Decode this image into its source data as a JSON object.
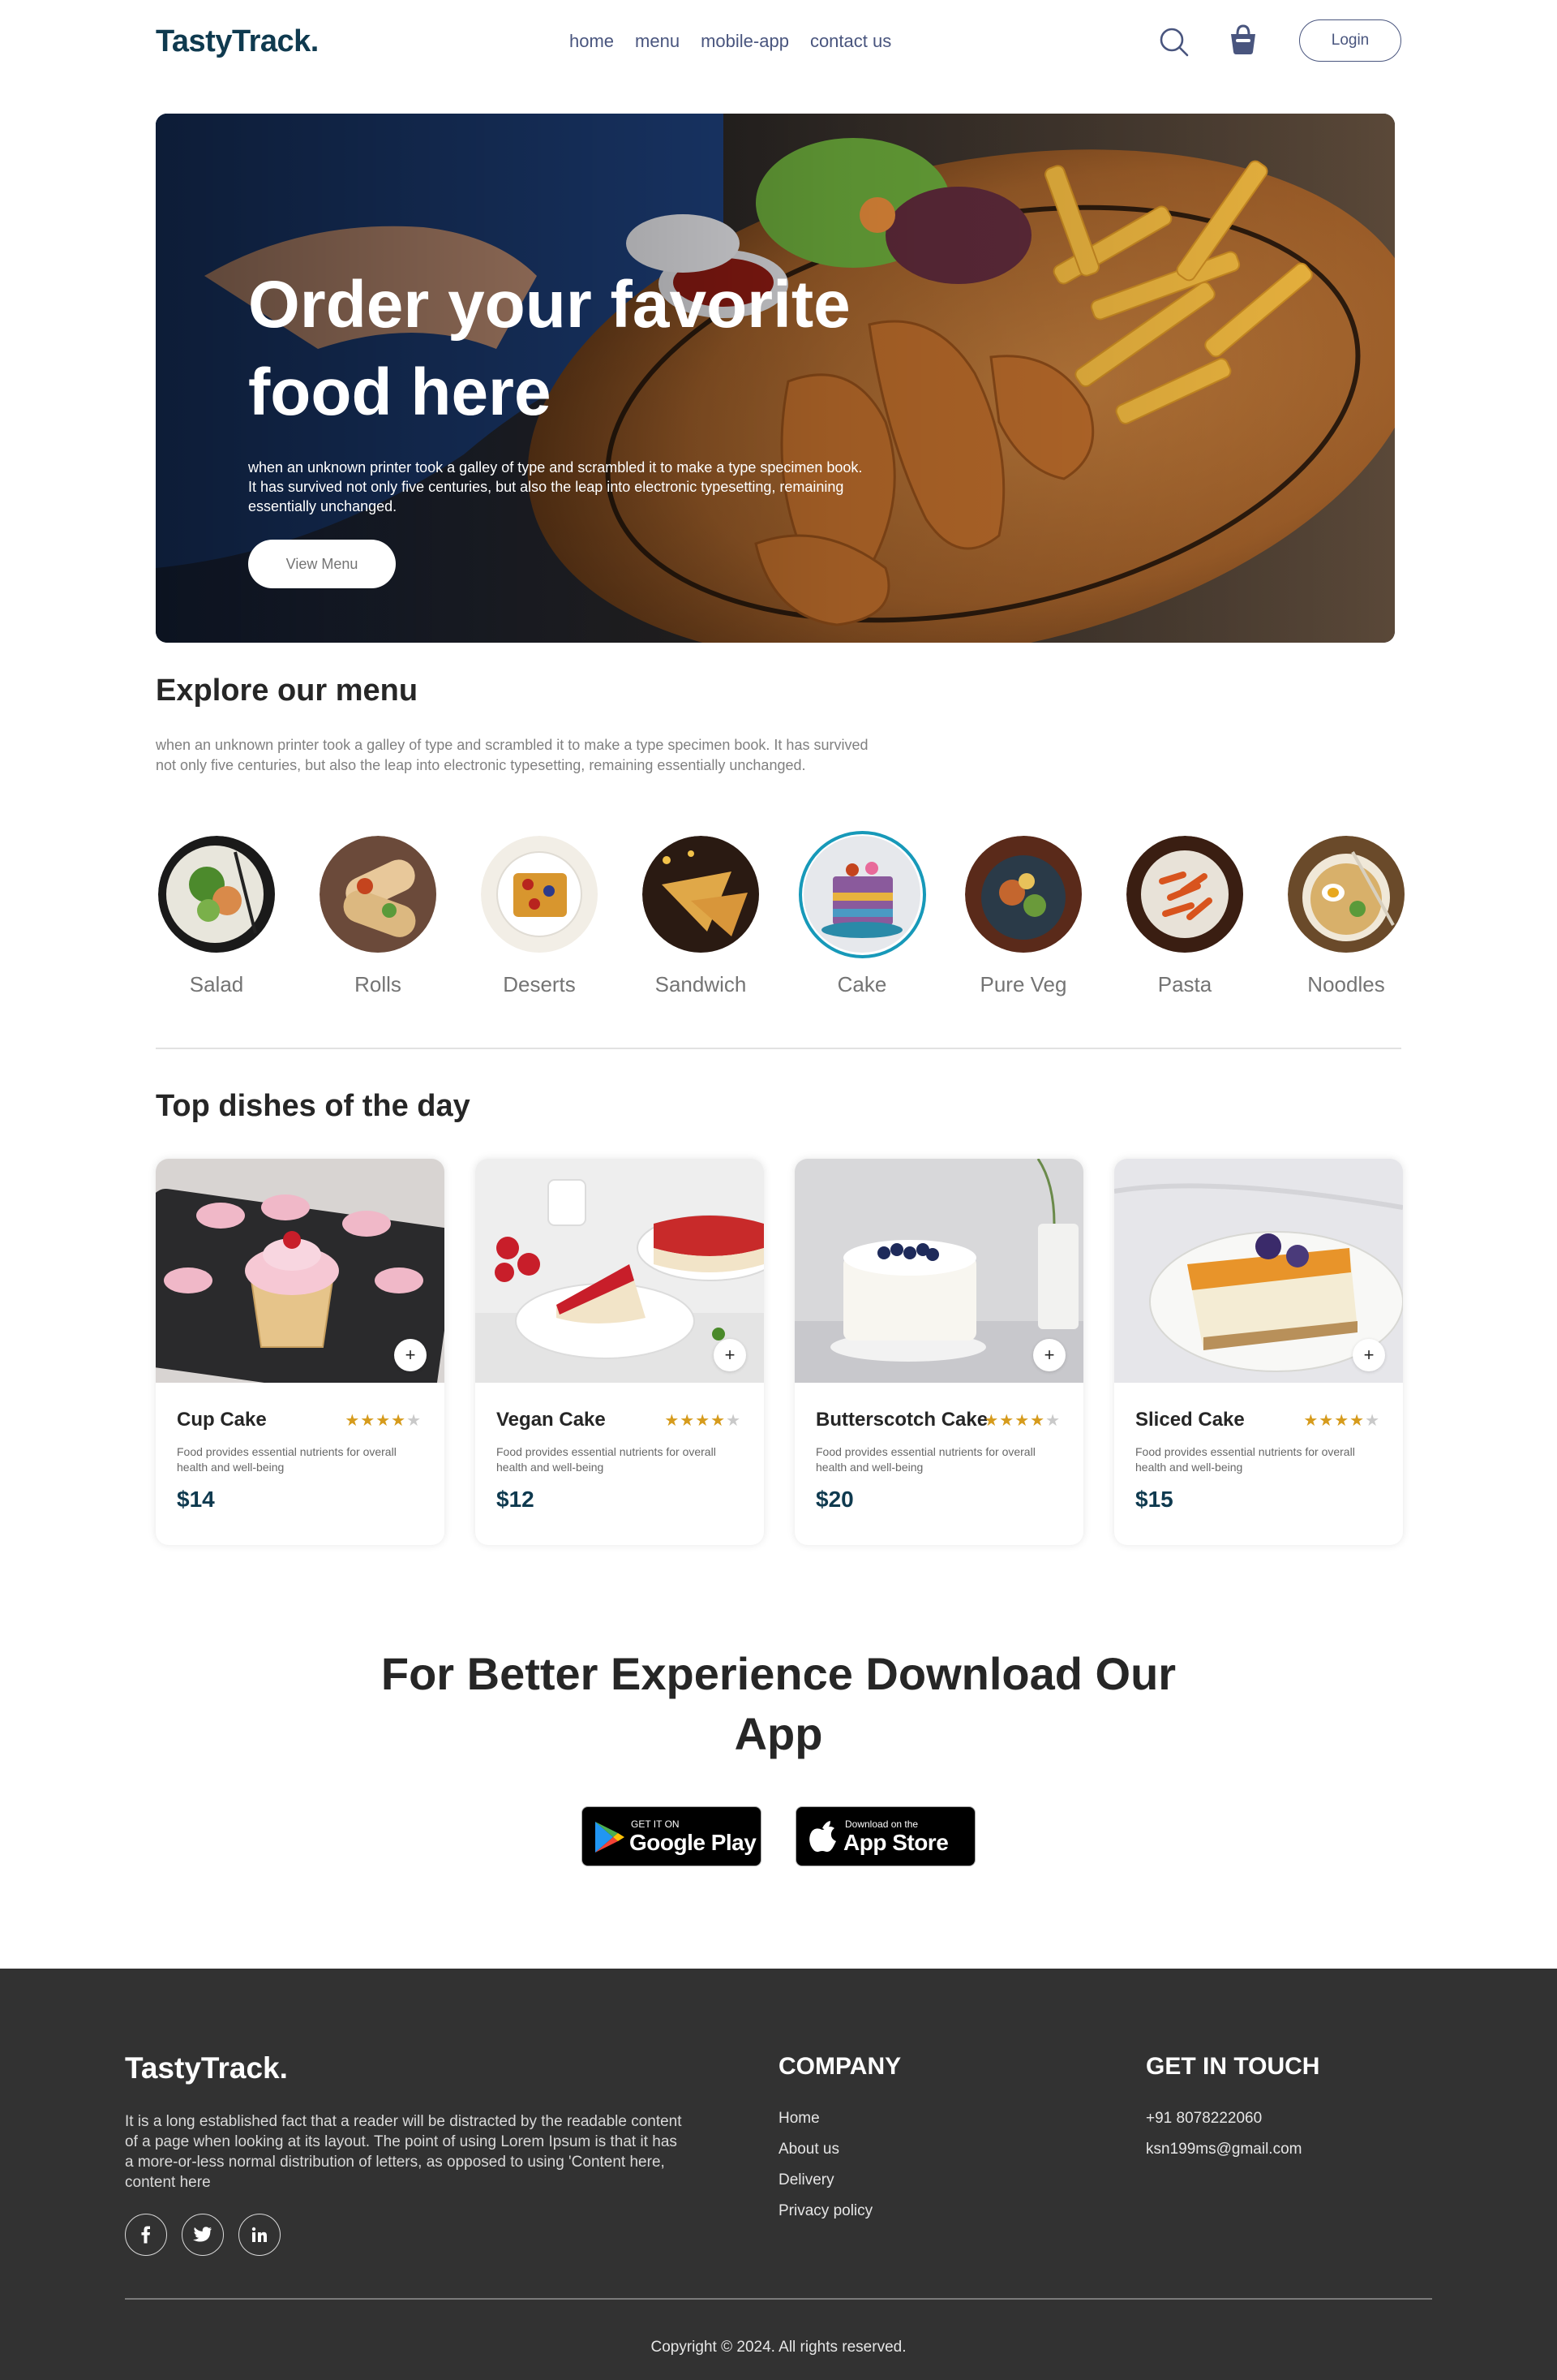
{
  "navbar": {
    "logo": "TastyTrack.",
    "links": [
      "home",
      "menu",
      "mobile-app",
      "contact us"
    ],
    "login_label": "Login"
  },
  "hero": {
    "title": "Order your favorite food here",
    "description": "when an unknown printer took a galley of type and scrambled it to make a type specimen book. It has survived not only five centuries, but also the leap into electronic typesetting, remaining essentially unchanged.",
    "button_label": "View Menu"
  },
  "explore": {
    "title": "Explore our menu",
    "description": "when an unknown printer took a galley of type and scrambled it to make a type specimen book. It has survived not only five centuries, but also the leap into electronic typesetting, remaining essentially unchanged.",
    "items": [
      {
        "label": "Salad",
        "color": "#4c7a2c"
      },
      {
        "label": "Rolls",
        "color": "#b5682e"
      },
      {
        "label": "Deserts",
        "color": "#c9862a"
      },
      {
        "label": "Sandwich",
        "color": "#d89a3a"
      },
      {
        "label": "Cake",
        "color": "#8a5a9c",
        "active": true
      },
      {
        "label": "Pure Veg",
        "color": "#3a5a6a"
      },
      {
        "label": "Pasta",
        "color": "#c4441e"
      },
      {
        "label": "Noodles",
        "color": "#a06a2c"
      }
    ]
  },
  "dishes": {
    "title": "Top dishes of the day",
    "items": [
      {
        "name": "Cup Cake",
        "description": "Food provides essential nutrients for overall health and well-being",
        "price": "$14",
        "rating": 4
      },
      {
        "name": "Vegan Cake",
        "description": "Food provides essential nutrients for overall health and well-being",
        "price": "$12",
        "rating": 4
      },
      {
        "name": "Butterscotch Cake",
        "description": "Food provides essential nutrients for overall health and well-being",
        "price": "$20",
        "rating": 4
      },
      {
        "name": "Sliced Cake",
        "description": "Food provides essential nutrients for overall health and well-being",
        "price": "$15",
        "rating": 4
      }
    ]
  },
  "app": {
    "title": "For Better Experience Download Our App",
    "google_small": "GET IT ON",
    "google_big": "Google Play",
    "apple_small": "Download on the",
    "apple_big": "App Store"
  },
  "footer": {
    "logo": "TastyTrack.",
    "about": "It is a long established fact that a reader will be distracted by the readable content of a page when looking at its layout. The point of using Lorem Ipsum is that it has a more-or-less normal distribution of letters, as opposed to using 'Content here, content here",
    "company_title": "COMPANY",
    "company_links": [
      "Home",
      "About us",
      "Delivery",
      "Privacy policy"
    ],
    "contact_title": "GET IN TOUCH",
    "phone": "+91 8078222060",
    "email": "ksn199ms@gmail.com",
    "copyright": "Copyright © 2024. All rights reserved."
  }
}
